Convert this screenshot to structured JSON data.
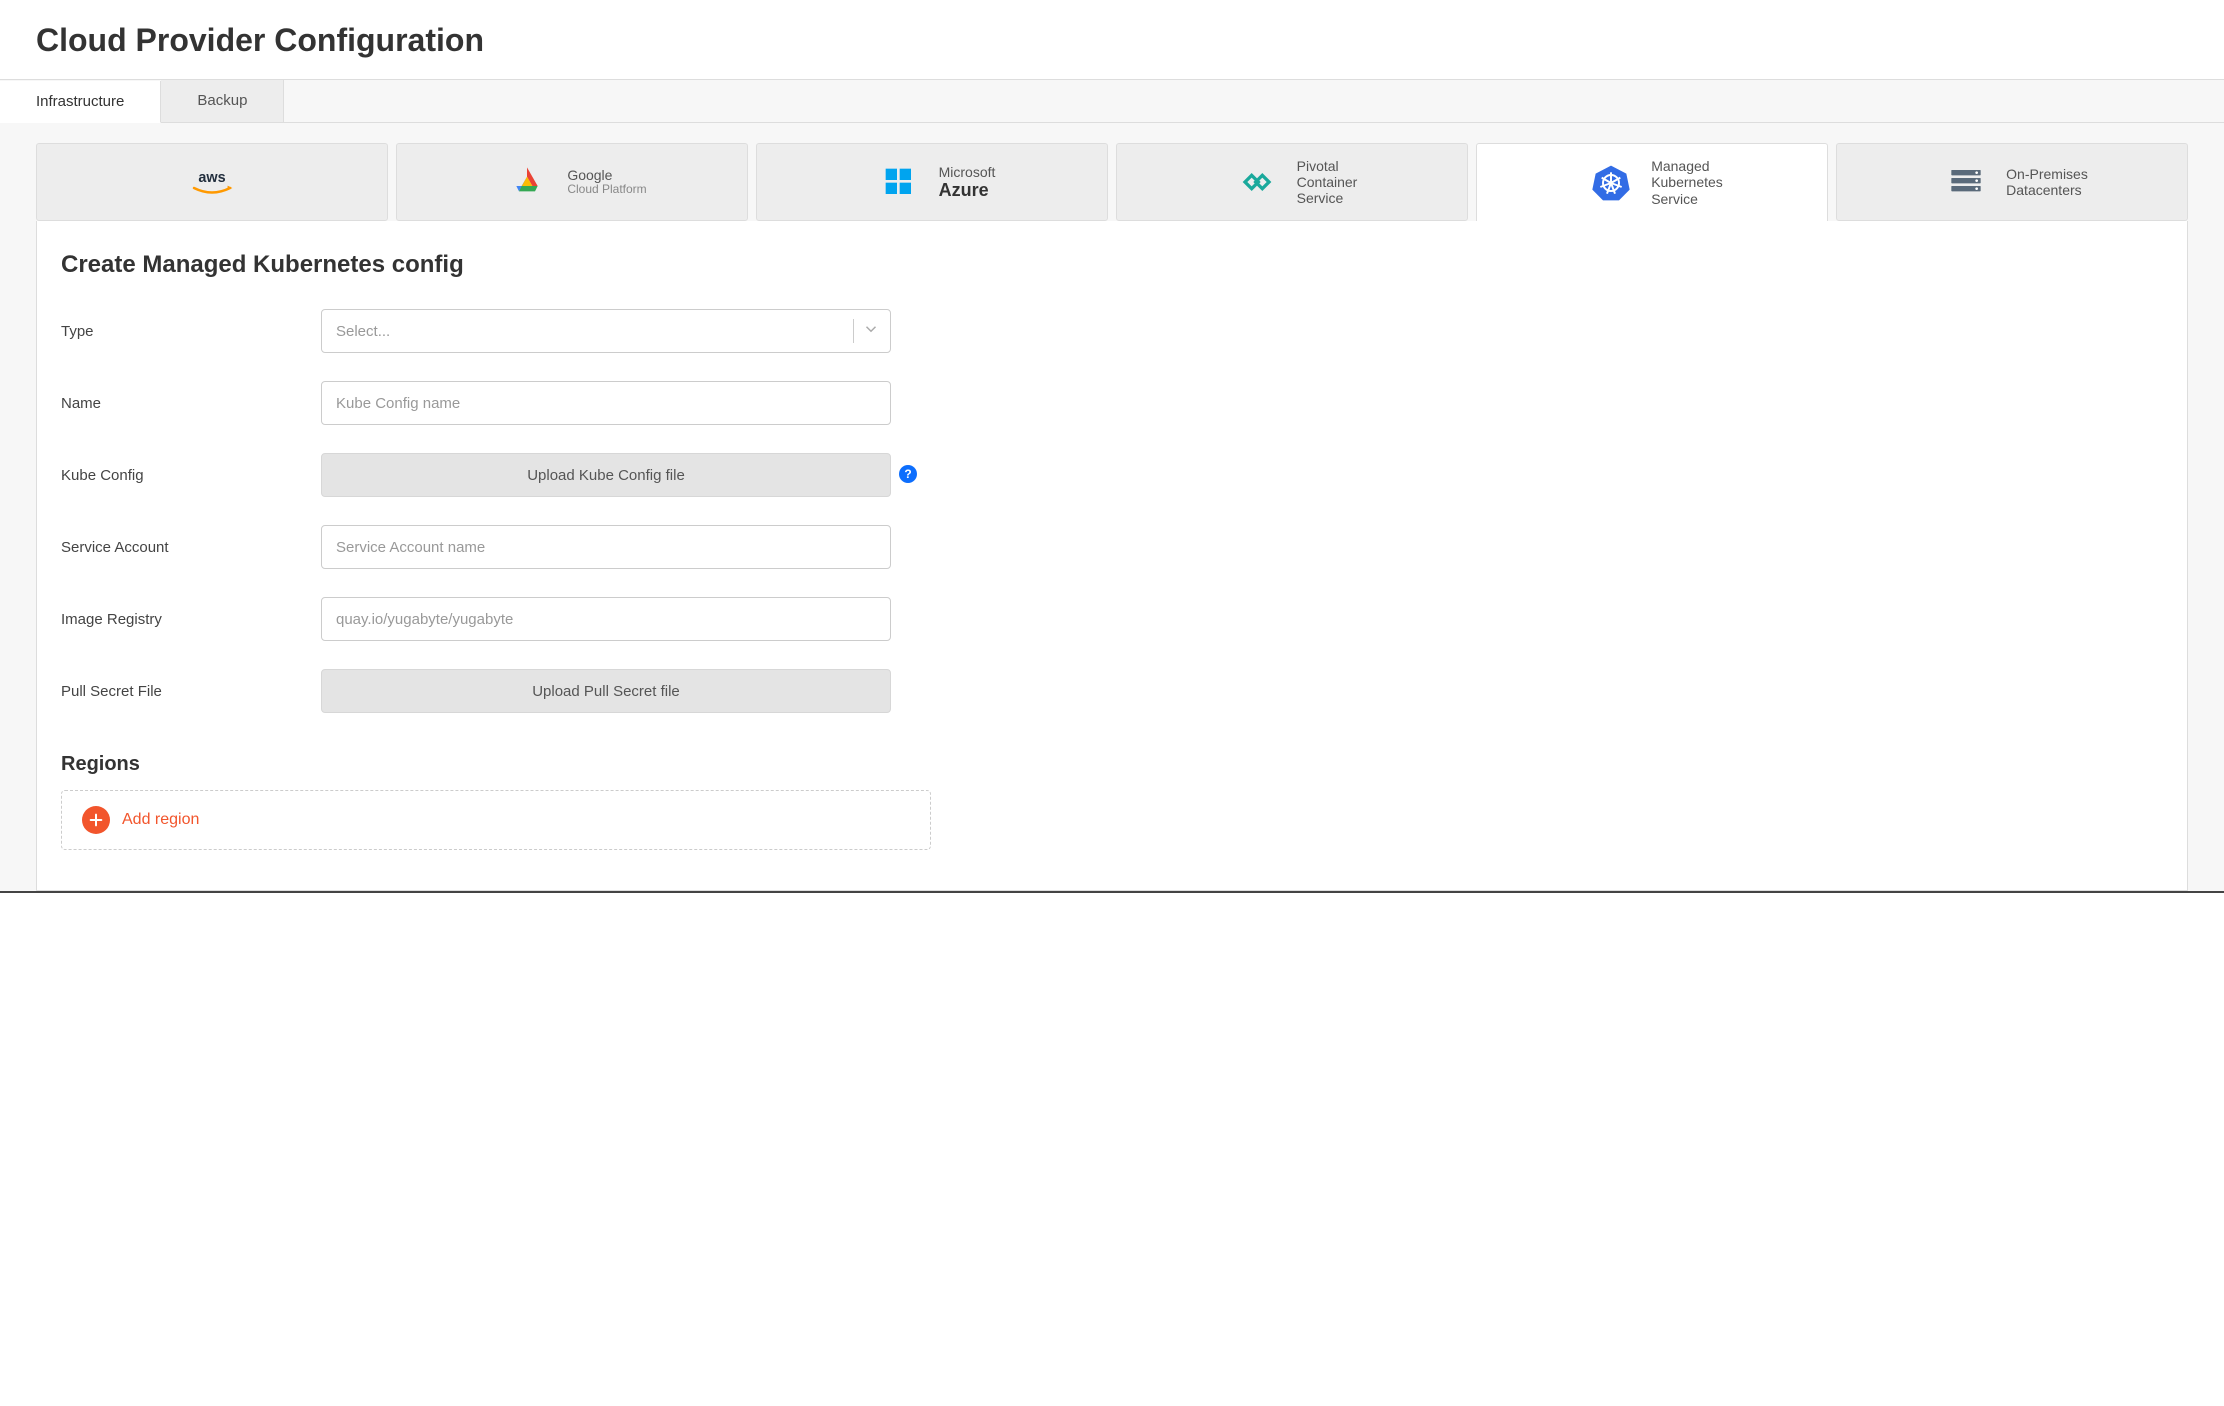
{
  "page_title": "Cloud Provider Configuration",
  "main_tabs": {
    "infrastructure": "Infrastructure",
    "backup": "Backup",
    "active": "infrastructure"
  },
  "providers": [
    {
      "id": "aws",
      "line1": "",
      "line2": "aws"
    },
    {
      "id": "gcp",
      "line1": "Google",
      "line2": "Cloud Platform"
    },
    {
      "id": "azure",
      "line1": "Microsoft",
      "line2": "Azure"
    },
    {
      "id": "pks",
      "line1": "Pivotal",
      "line2": "Container",
      "line3": "Service"
    },
    {
      "id": "mks",
      "line1": "Managed",
      "line2": "Kubernetes",
      "line3": "Service"
    },
    {
      "id": "onprem",
      "line1": "On-Premises",
      "line2": "Datacenters"
    }
  ],
  "active_provider": "mks",
  "form": {
    "title": "Create Managed Kubernetes config",
    "type_label": "Type",
    "type_placeholder": "Select...",
    "name_label": "Name",
    "name_placeholder": "Kube Config name",
    "kubeconfig_label": "Kube Config",
    "kubeconfig_button": "Upload Kube Config file",
    "service_account_label": "Service Account",
    "service_account_placeholder": "Service Account name",
    "image_registry_label": "Image Registry",
    "image_registry_placeholder": "quay.io/yugabyte/yugabyte",
    "pull_secret_label": "Pull Secret File",
    "pull_secret_button": "Upload Pull Secret file"
  },
  "regions": {
    "heading": "Regions",
    "add_label": "Add region"
  }
}
